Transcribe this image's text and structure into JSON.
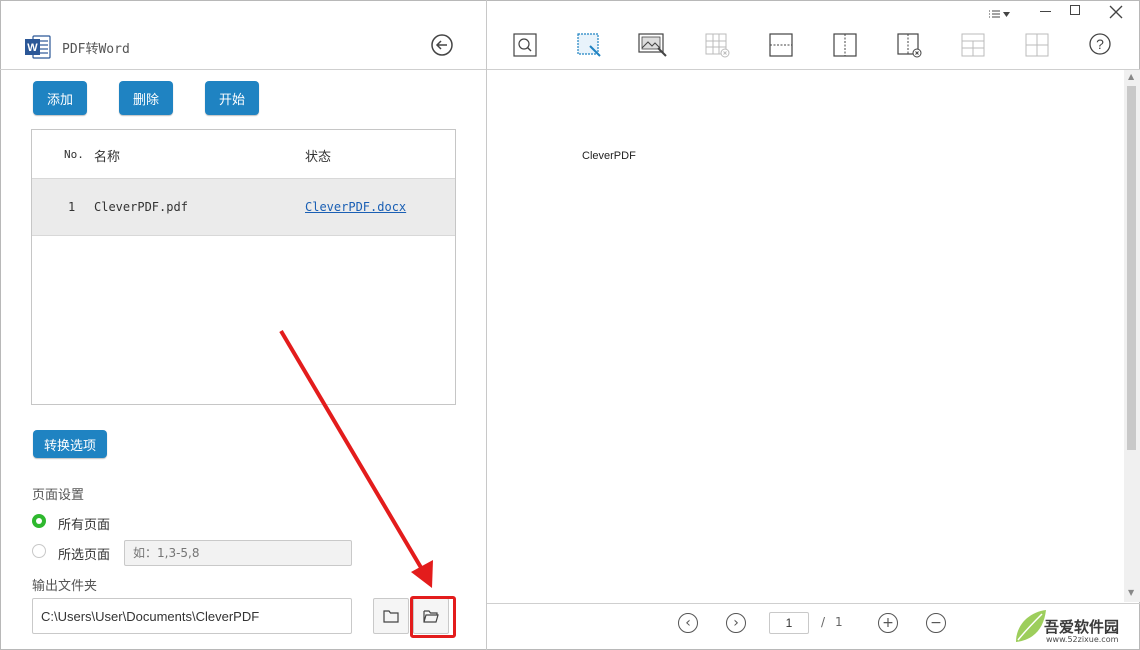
{
  "app": {
    "title": "PDF转Word"
  },
  "toolbar_left": {
    "add": "添加",
    "delete": "删除",
    "start": "开始"
  },
  "file_table": {
    "columns": [
      "No.",
      "名称",
      "状态"
    ],
    "rows": [
      {
        "no": "1",
        "name": "CleverPDF.pdf",
        "status": "CleverPDF.docx"
      }
    ]
  },
  "options_button": "转换选项",
  "page_settings": {
    "heading": "页面设置",
    "all_pages": "所有页面",
    "selected_pages": "所选页面",
    "range_placeholder": "如：1,3-5,8",
    "selected": "all"
  },
  "output": {
    "heading": "输出文件夹",
    "path": "C:\\Users\\User\\Documents\\CleverPDF"
  },
  "preview": {
    "text": "CleverPDF"
  },
  "pager": {
    "current": "1",
    "separator": "/",
    "total": "1"
  },
  "watermark": {
    "line1": "吾爱软件园",
    "line2": "www.52zixue.com"
  },
  "colors": {
    "accent": "#1f83c2",
    "radio_selected": "#2eb82e",
    "highlight": "#e31c1c"
  }
}
